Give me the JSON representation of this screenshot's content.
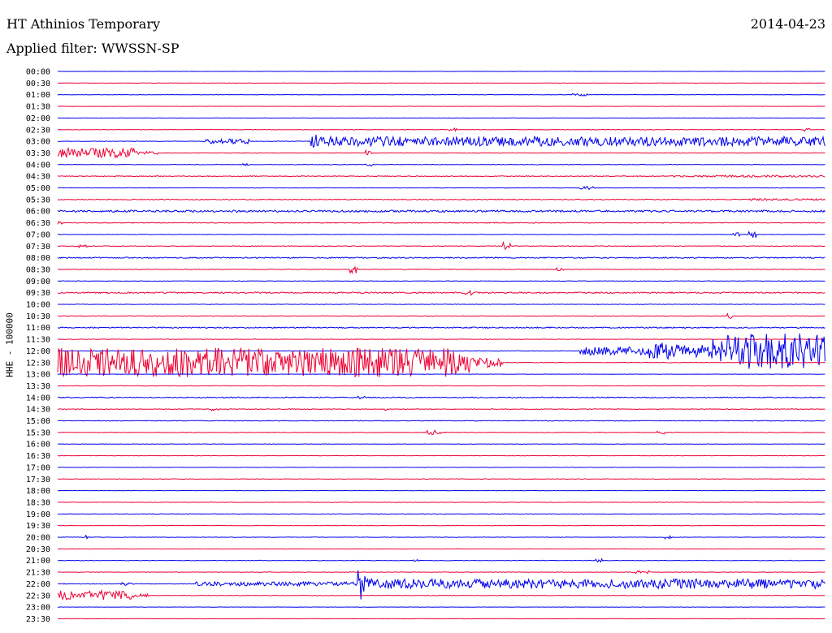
{
  "header": {
    "station": "HT Athinios Temporary",
    "date": "2014-04-23",
    "filter": "Applied filter: WWSSN-SP"
  },
  "chart_data": {
    "type": "line",
    "title": "HT Athinios Temporary",
    "date": "2014-04-23",
    "filter": "Applied filter: WWSSN-SP",
    "ylabel": "HHE - 100000",
    "line_colors": [
      "#0000ee",
      "#ee0033"
    ],
    "tick_labels": [
      "00:00",
      "00:30",
      "01:00",
      "01:30",
      "02:00",
      "02:30",
      "03:00",
      "03:30",
      "04:00",
      "04:30",
      "05:00",
      "05:30",
      "06:00",
      "06:30",
      "07:00",
      "07:30",
      "08:00",
      "08:30",
      "09:00",
      "09:30",
      "10:00",
      "10:30",
      "11:00",
      "11:30",
      "12:00",
      "12:30",
      "13:00",
      "13:30",
      "14:00",
      "14:30",
      "15:00",
      "15:30",
      "16:00",
      "16:30",
      "17:00",
      "17:30",
      "18:00",
      "18:30",
      "19:00",
      "19:30",
      "20:00",
      "20:30",
      "21:00",
      "21:30",
      "22:00",
      "22:30",
      "23:00",
      "23:30"
    ],
    "series": [
      {
        "line": "00:00",
        "base": 0.2,
        "events": []
      },
      {
        "line": "00:30",
        "base": 0.2,
        "events": []
      },
      {
        "line": "01:00",
        "base": 0.2,
        "events": [
          [
            0.67,
            0.69,
            1.5
          ]
        ]
      },
      {
        "line": "01:30",
        "base": 0.2,
        "events": []
      },
      {
        "line": "02:00",
        "base": 0.2,
        "events": []
      },
      {
        "line": "02:30",
        "base": 0.3,
        "events": [
          [
            0.51,
            0.52,
            2
          ],
          [
            0.97,
            0.98,
            2
          ]
        ]
      },
      {
        "line": "03:00",
        "base": 0.3,
        "events": [
          [
            0.19,
            0.25,
            3
          ],
          [
            0.33,
            0.34,
            9
          ],
          [
            0.34,
            1.0,
            6
          ]
        ]
      },
      {
        "line": "03:30",
        "base": 0.3,
        "events": [
          [
            0.0,
            0.1,
            6
          ],
          [
            0.1,
            0.13,
            2
          ],
          [
            0.4,
            0.41,
            4
          ]
        ]
      },
      {
        "line": "04:00",
        "base": 0.3,
        "events": [
          [
            0.24,
            0.25,
            2
          ],
          [
            0.4,
            0.41,
            2
          ]
        ]
      },
      {
        "line": "04:30",
        "base": 0.5,
        "events": [
          [
            0.8,
            1.0,
            1.2
          ]
        ]
      },
      {
        "line": "05:00",
        "base": 0.3,
        "events": [
          [
            0.68,
            0.7,
            2
          ]
        ]
      },
      {
        "line": "05:30",
        "base": 0.5,
        "events": [
          [
            0.9,
            1.0,
            1.2
          ]
        ]
      },
      {
        "line": "06:00",
        "base": 1.2,
        "events": []
      },
      {
        "line": "06:30",
        "base": 0.5,
        "events": [
          [
            0.0,
            0.01,
            2
          ]
        ]
      },
      {
        "line": "07:00",
        "base": 0.3,
        "events": [
          [
            0.88,
            0.89,
            2.5
          ],
          [
            0.9,
            0.91,
            4
          ]
        ]
      },
      {
        "line": "07:30",
        "base": 0.4,
        "events": [
          [
            0.02,
            0.04,
            2
          ],
          [
            0.58,
            0.59,
            5
          ]
        ]
      },
      {
        "line": "08:00",
        "base": 0.7,
        "events": []
      },
      {
        "line": "08:30",
        "base": 0.4,
        "events": [
          [
            0.38,
            0.39,
            5
          ],
          [
            0.65,
            0.66,
            2
          ]
        ]
      },
      {
        "line": "09:00",
        "base": 0.3,
        "events": []
      },
      {
        "line": "09:30",
        "base": 0.8,
        "events": [
          [
            0.53,
            0.54,
            3
          ]
        ]
      },
      {
        "line": "10:00",
        "base": 0.3,
        "events": []
      },
      {
        "line": "10:30",
        "base": 0.3,
        "events": [
          [
            0.87,
            0.88,
            3
          ]
        ]
      },
      {
        "line": "11:00",
        "base": 0.7,
        "events": []
      },
      {
        "line": "11:30",
        "base": 0.3,
        "events": []
      },
      {
        "line": "12:00",
        "base": 0.3,
        "events": [
          [
            0.68,
            0.77,
            5
          ],
          [
            0.77,
            0.8,
            10
          ],
          [
            0.8,
            0.85,
            8
          ],
          [
            0.85,
            1.0,
            22
          ]
        ]
      },
      {
        "line": "12:30",
        "base": 0.3,
        "events": [
          [
            0.0,
            0.54,
            18
          ],
          [
            0.54,
            0.58,
            6
          ]
        ]
      },
      {
        "line": "13:00",
        "base": 0.2,
        "events": []
      },
      {
        "line": "13:30",
        "base": 0.3,
        "events": []
      },
      {
        "line": "14:00",
        "base": 0.6,
        "events": [
          [
            0.39,
            0.4,
            2
          ]
        ]
      },
      {
        "line": "14:30",
        "base": 0.4,
        "events": [
          [
            0.2,
            0.21,
            2
          ],
          [
            0.42,
            0.43,
            2
          ]
        ]
      },
      {
        "line": "15:00",
        "base": 0.4,
        "events": []
      },
      {
        "line": "15:30",
        "base": 0.4,
        "events": [
          [
            0.48,
            0.5,
            3
          ],
          [
            0.78,
            0.79,
            2
          ]
        ]
      },
      {
        "line": "16:00",
        "base": 0.2,
        "events": []
      },
      {
        "line": "16:30",
        "base": 0.2,
        "events": []
      },
      {
        "line": "17:00",
        "base": 0.2,
        "events": []
      },
      {
        "line": "17:30",
        "base": 0.3,
        "events": []
      },
      {
        "line": "18:00",
        "base": 0.2,
        "events": []
      },
      {
        "line": "18:30",
        "base": 0.3,
        "events": []
      },
      {
        "line": "19:00",
        "base": 0.3,
        "events": []
      },
      {
        "line": "19:30",
        "base": 0.2,
        "events": []
      },
      {
        "line": "20:00",
        "base": 0.3,
        "events": [
          [
            0.03,
            0.04,
            3
          ],
          [
            0.79,
            0.8,
            2
          ]
        ]
      },
      {
        "line": "20:30",
        "base": 0.2,
        "events": []
      },
      {
        "line": "21:00",
        "base": 0.3,
        "events": [
          [
            0.46,
            0.47,
            2
          ],
          [
            0.7,
            0.71,
            2
          ]
        ]
      },
      {
        "line": "21:30",
        "base": 0.3,
        "events": [
          [
            0.75,
            0.77,
            2
          ]
        ]
      },
      {
        "line": "22:00",
        "base": 0.4,
        "events": [
          [
            0.08,
            0.1,
            2
          ],
          [
            0.18,
            0.39,
            2.5
          ],
          [
            0.39,
            0.4,
            22
          ],
          [
            0.4,
            1.0,
            6
          ]
        ]
      },
      {
        "line": "22:30",
        "base": 0.3,
        "events": [
          [
            0.0,
            0.1,
            6
          ],
          [
            0.1,
            0.12,
            2
          ]
        ]
      },
      {
        "line": "23:00",
        "base": 0.2,
        "events": []
      },
      {
        "line": "23:30",
        "base": 0.2,
        "events": []
      }
    ]
  }
}
